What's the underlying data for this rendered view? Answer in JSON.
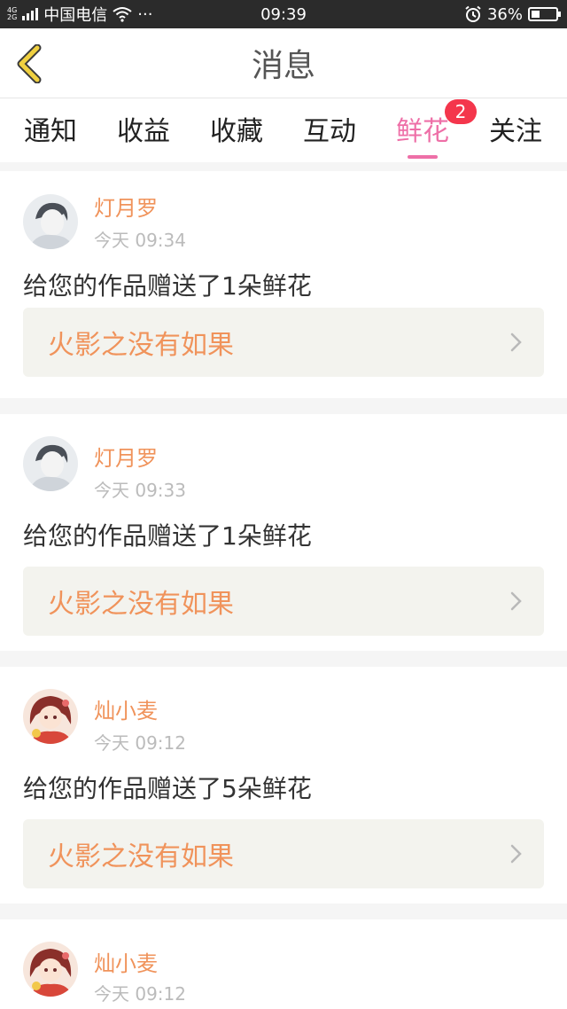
{
  "status_bar": {
    "network_type_top": "4G",
    "network_type_bottom": "2G",
    "carrier": "中国电信",
    "more": "···",
    "time": "09:39",
    "battery": "36%",
    "battery_level": 0.36
  },
  "header": {
    "title": "消息",
    "back_icon": "chevron-left-icon",
    "accent_color": "#f0d040"
  },
  "tabs": [
    {
      "label": "通知"
    },
    {
      "label": "收益"
    },
    {
      "label": "收藏"
    },
    {
      "label": "互动"
    },
    {
      "label": "鲜花",
      "active": true,
      "badge": "2"
    },
    {
      "label": "关注"
    }
  ],
  "messages": [
    {
      "user": "灯月罗",
      "avatar": "avatar-sketch-person",
      "time": "今天 09:34",
      "text": "给您的作品赠送了1朵鲜花",
      "work_title": "火影之没有如果"
    },
    {
      "user": "灯月罗",
      "avatar": "avatar-sketch-person",
      "time": "今天 09:33",
      "text": "给您的作品赠送了1朵鲜花",
      "work_title": "火影之没有如果"
    },
    {
      "user": "灿小麦",
      "avatar": "avatar-anime-girl",
      "time": "今天 09:12",
      "text": "给您的作品赠送了5朵鲜花",
      "work_title": "火影之没有如果"
    },
    {
      "user": "灿小麦",
      "avatar": "avatar-anime-girl",
      "time": "今天 09:12",
      "text": "",
      "work_title": ""
    }
  ],
  "colors": {
    "accent_pink": "#ee6fa7",
    "name_orange": "#f0935b",
    "badge_red": "#f4364c",
    "work_bg": "#f3f3ee"
  }
}
